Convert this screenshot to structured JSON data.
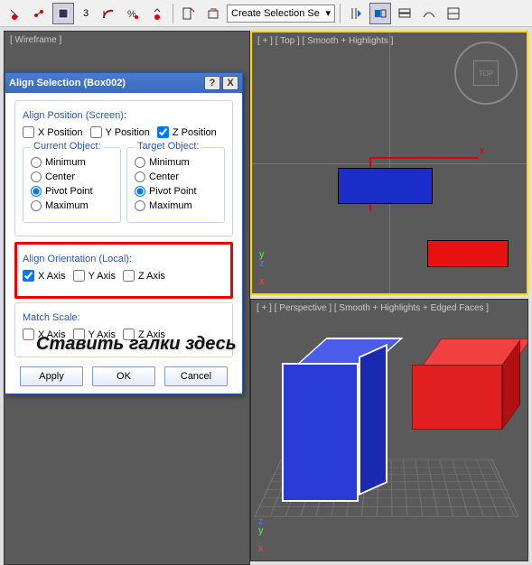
{
  "toolbar": {
    "spinner_value": "3",
    "combo_text": "Create Selection Se"
  },
  "viewports": {
    "wireframe_label": "[ Wireframe ]",
    "top_label": "[ + ] [ Top ] [ Smooth + Highlights ]",
    "persp_label": "[ + ] [ Perspective ] [ Smooth + Highlights + Edged Faces ]",
    "viewcube_face": "TOP",
    "axis_x": "x",
    "axis_y": "y",
    "axis_z": "z"
  },
  "dialog": {
    "title": "Align Selection (Box002)",
    "help": "?",
    "close": "X",
    "align_position_label": "Align Position (Screen):",
    "x_pos": "X Position",
    "y_pos": "Y Position",
    "z_pos": "Z Position",
    "current_obj": "Current Object:",
    "target_obj": "Target Object:",
    "minimum": "Minimum",
    "center": "Center",
    "pivot": "Pivot Point",
    "maximum": "Maximum",
    "align_orient_label": "Align Orientation (Local):",
    "x_axis": "X Axis",
    "y_axis": "Y Axis",
    "z_axis": "Z Axis",
    "match_scale": "Match Scale:",
    "apply": "Apply",
    "ok": "OK",
    "cancel": "Cancel"
  },
  "overlay": "Ставить галки здесь"
}
